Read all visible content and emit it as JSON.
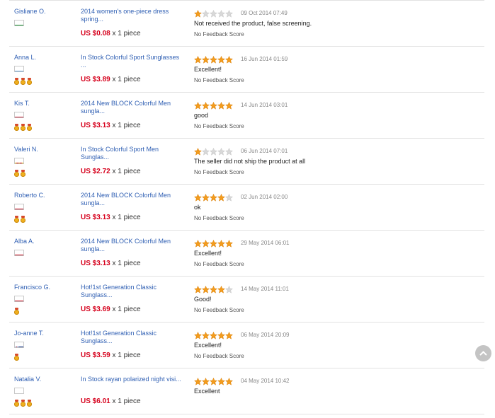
{
  "feedback": [
    {
      "buyer": "Gisliane O.",
      "flag": "br",
      "medals": 0,
      "product": "2014 women's one-piece dress spring...",
      "price": "US $0.08",
      "qty": "x 1 piece",
      "rating": 1,
      "date": "09 Oct 2014 07:49",
      "comment": "Not received the product, false screening.",
      "score": "No Feedback Score"
    },
    {
      "buyer": "Anna L.",
      "flag": "un",
      "medals": 3,
      "product": "In Stock Colorful Sport Sunglasses ...",
      "price": "US $3.89",
      "qty": "x 1 piece",
      "rating": 5,
      "date": "16 Jun 2014 01:59",
      "comment": "Excellent!",
      "score": "No Feedback Score"
    },
    {
      "buyer": "Kis T.",
      "flag": "hu",
      "medals": 3,
      "product": "2014 New BLOCK Colorful Men sungla...",
      "price": "US $3.13",
      "qty": "x 1 piece",
      "rating": 5,
      "date": "14 Jun 2014 03:01",
      "comment": "good",
      "score": "No Feedback Score"
    },
    {
      "buyer": "Valeri N.",
      "flag": "mk",
      "medals": 2,
      "product": "In Stock Colorful Sport Men Sunglas...",
      "price": "US $2.72",
      "qty": "x 1 piece",
      "rating": 1,
      "date": "06 Jun 2014 07:01",
      "comment": "The seller did not ship the product at all",
      "score": "No Feedback Score"
    },
    {
      "buyer": "Roberto C.",
      "flag": "es",
      "medals": 2,
      "product": "2014 New BLOCK Colorful Men sungla...",
      "price": "US $3.13",
      "qty": "x 1 piece",
      "rating": 4,
      "date": "02 Jun 2014 02:00",
      "comment": "ok",
      "score": "No Feedback Score"
    },
    {
      "buyer": "Alba A.",
      "flag": "es",
      "medals": 0,
      "product": "2014 New BLOCK Colorful Men sungla...",
      "price": "US $3.13",
      "qty": "x 1 piece",
      "rating": 5,
      "date": "29 May 2014 06:01",
      "comment": "Excellent!",
      "score": "No Feedback Score"
    },
    {
      "buyer": "Francisco G.",
      "flag": "es",
      "medals": 1,
      "product": "Hot!1st Generation Classic Sunglass...",
      "price": "US $3.69",
      "qty": "x 1 piece",
      "rating": 4,
      "date": "14 May 2014 11:01",
      "comment": "Good!",
      "score": "No Feedback Score"
    },
    {
      "buyer": "Jo-anne T.",
      "flag": "au",
      "medals": 1,
      "product": "Hot!1st Generation Classic Sunglass...",
      "price": "US $3.59",
      "qty": "x 1 piece",
      "rating": 5,
      "date": "06 May 2014 20:09",
      "comment": "Excellent!",
      "score": "No Feedback Score"
    },
    {
      "buyer": "Natalia V.",
      "flag": "ru",
      "medals": 3,
      "product": "In Stock rayan polarized night visi...",
      "price": "US $6.01",
      "qty": "x 1 piece",
      "rating": 5,
      "date": "04 May 2014 10:42",
      "comment": "Excellent",
      "score": ""
    }
  ],
  "colors": {
    "star_on": "#f39c1e",
    "star_off": "#d8d8d8",
    "price": "#d6001c",
    "link": "#2f5fb3"
  },
  "back_to_top_icon": "chevron-up-icon"
}
